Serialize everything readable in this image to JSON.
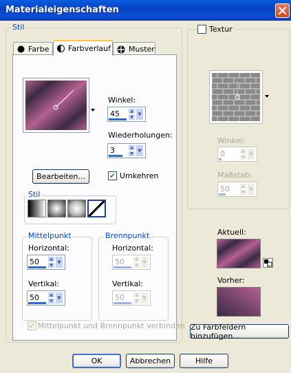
{
  "window": {
    "title": "Materialeigenschaften"
  },
  "left": {
    "group_label": "Stil",
    "tabs": [
      {
        "label": "Farbe",
        "icon": "filled-circle-icon"
      },
      {
        "label": "Farbverlauf",
        "icon": "gradient-circle-icon"
      },
      {
        "label": "Muster",
        "icon": "pattern-icon"
      }
    ],
    "winkel_label": "Winkel:",
    "winkel_value": "45",
    "wiederholungen_label": "Wiederholungen:",
    "wiederholungen_value": "3",
    "bearbeiten_label": "Bearbeiten...",
    "umkehren_label": "Umkehren",
    "umkehren_checked": true,
    "stil_label": "Stil",
    "mittelpunkt": {
      "label": "Mittelpunkt",
      "horizontal_label": "Horizontal:",
      "horizontal_value": "50",
      "vertikal_label": "Vertikal:",
      "vertikal_value": "50"
    },
    "brennpunkt": {
      "label": "Brennpunkt",
      "horizontal_label": "Horizontal:",
      "horizontal_value": "50",
      "vertikal_label": "Vertikal:",
      "vertikal_value": "50"
    },
    "verbinden_label": "Mittelpunkt und Brennpunkt verbinden",
    "verbinden_checked": true
  },
  "right": {
    "textur_label": "Textur",
    "textur_checked": false,
    "winkel_label": "Winkel:",
    "winkel_value": "0",
    "massstab_label": "Maßstab:",
    "massstab_value": "50",
    "aktuell_label": "Aktuell:",
    "vorher_label": "Vorher:",
    "hinzufuegen_label": "Zu Farbfeldern hinzufügen..."
  },
  "buttons": {
    "ok": "OK",
    "abbrechen": "Abbrechen",
    "hilfe": "Hilfe"
  },
  "colors": {
    "gradient_dark": "#3a2a44",
    "gradient_pink": "#b36090",
    "accent_blue": "#0046d5"
  }
}
